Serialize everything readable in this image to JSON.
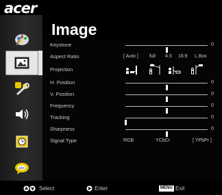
{
  "brand": {
    "logo_text": "acer"
  },
  "menu": {
    "title": "Image",
    "tabs": [
      {
        "name": "color",
        "icon": "palette-icon",
        "active": false
      },
      {
        "name": "image",
        "icon": "picture-icon",
        "active": true
      },
      {
        "name": "setting",
        "icon": "wrench-icon",
        "active": false
      },
      {
        "name": "audio",
        "icon": "speaker-icon",
        "active": false
      },
      {
        "name": "timer",
        "icon": "clock-icon",
        "active": false
      },
      {
        "name": "language",
        "icon": "language-bubble-icon",
        "active": false
      }
    ]
  },
  "rows": {
    "keystone": {
      "label": "Keystone",
      "value": "0",
      "level": 0.5
    },
    "aspect_ratio": {
      "label": "Aspect Ratio",
      "options": [
        "[ Auto ]",
        "full",
        "4:3",
        "16:9",
        "L.Box"
      ],
      "selected": "[ Auto ]"
    },
    "projection": {
      "label": "Projection",
      "options": [
        "front-desktop-icon",
        "front-ceiling-icon",
        "rear-desktop-icon",
        "rear-ceiling-icon"
      ],
      "selected": "front-desktop-icon"
    },
    "h_position": {
      "label": "H. Position",
      "value": "0",
      "level": 0.5
    },
    "v_position": {
      "label": "V. Position",
      "value": "0",
      "level": 0.5
    },
    "frequency": {
      "label": "Frequency",
      "value": "0",
      "level": 0.5
    },
    "tracking": {
      "label": "Tracking",
      "value": "0",
      "level": 0.0
    },
    "sharpness": {
      "label": "Sharpness",
      "value": "0",
      "level": 0.5
    },
    "signal_type": {
      "label": "Signal Type",
      "options": [
        "RGB",
        "YCbCr",
        "[ YPbPr ]"
      ],
      "selected": "[ YPbPr ]"
    }
  },
  "footer": {
    "select_label": "Select",
    "enter_label": "Enter",
    "menu_key": "MENU",
    "exit_label": "Exit"
  }
}
